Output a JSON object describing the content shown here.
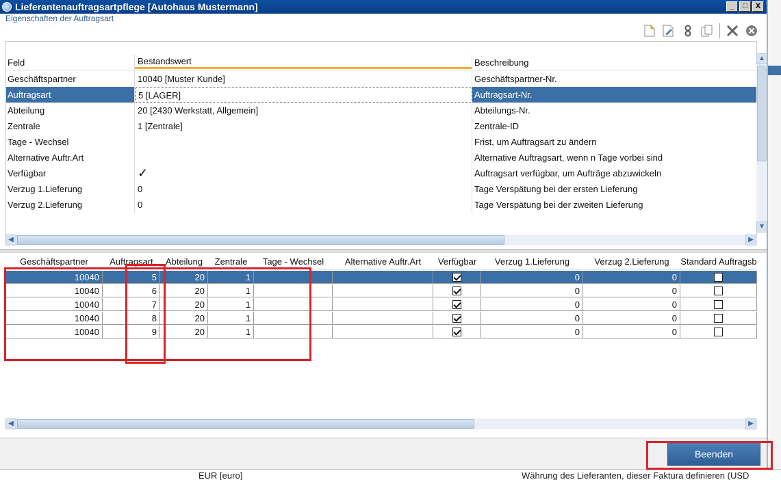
{
  "window": {
    "title": "Lieferantenauftragsartpflege [Autohaus Mustermann]",
    "subtitle": "Eigenschaften der Auftragsart",
    "controls": [
      "_",
      "□",
      "X"
    ]
  },
  "toolbar": {
    "icons": [
      "new-document-icon",
      "edit-document-icon",
      "link-icon",
      "copy-icon",
      "delete-icon",
      "close-circle-icon"
    ]
  },
  "properties": {
    "headers": {
      "field": "Feld",
      "value": "Bestandswert",
      "description": "Beschreibung"
    },
    "rows": [
      {
        "field": "Geschäftspartner",
        "value": "10040   [Muster Kunde]",
        "description": "Geschäftspartner-Nr."
      },
      {
        "field": "Auftragsart",
        "value": "5   [LAGER]",
        "description": "Auftragsart-Nr."
      },
      {
        "field": "Abteilung",
        "value": "20   [2430 Werkstatt,  Allgemein]",
        "description": "Abteilungs-Nr."
      },
      {
        "field": "Zentrale",
        "value": "1   [Zentrale]",
        "description": "Zentrale-ID"
      },
      {
        "field": "Tage - Wechsel",
        "value": "",
        "description": "Frist, um Auftragsart zu ändern"
      },
      {
        "field": "Alternative Auftr.Art",
        "value": "",
        "description": "Alternative Auftragsart, wenn n Tage vorbei sind"
      },
      {
        "field": "Verfügbar",
        "value": "✓",
        "description": "Auftragsart verfügbar, um Aufträge abzuwickeln"
      },
      {
        "field": "Verzug 1.Lieferung",
        "value": "0",
        "description": "Tage Verspätung bei der ersten Lieferung"
      },
      {
        "field": "Verzug 2.Lieferung",
        "value": "0",
        "description": "Tage Verspätung bei der zweiten Lieferung"
      }
    ]
  },
  "table": {
    "columns": [
      "Geschäftspartner",
      "Auftragsart",
      "Abteilung",
      "Zentrale",
      "Tage - Wechsel",
      "Alternative Auftr.Art",
      "Verfügbar",
      "Verzug 1.Lieferung",
      "Verzug 2.Lieferung",
      "Standard Auftragsb"
    ],
    "rows": [
      {
        "partner": "10040",
        "art": "5",
        "abteilung": "20",
        "zentrale": "1",
        "tage": "",
        "alt": "",
        "verfuegbar": true,
        "verzug1": "0",
        "verzug2": "0",
        "standard": false
      },
      {
        "partner": "10040",
        "art": "6",
        "abteilung": "20",
        "zentrale": "1",
        "tage": "",
        "alt": "",
        "verfuegbar": true,
        "verzug1": "0",
        "verzug2": "0",
        "standard": false
      },
      {
        "partner": "10040",
        "art": "7",
        "abteilung": "20",
        "zentrale": "1",
        "tage": "",
        "alt": "",
        "verfuegbar": true,
        "verzug1": "0",
        "verzug2": "0",
        "standard": false
      },
      {
        "partner": "10040",
        "art": "8",
        "abteilung": "20",
        "zentrale": "1",
        "tage": "",
        "alt": "",
        "verfuegbar": true,
        "verzug1": "0",
        "verzug2": "0",
        "standard": false
      },
      {
        "partner": "10040",
        "art": "9",
        "abteilung": "20",
        "zentrale": "1",
        "tage": "",
        "alt": "",
        "verfuegbar": true,
        "verzug1": "0",
        "verzug2": "0",
        "standard": false
      }
    ]
  },
  "footer": {
    "close_label": "Beenden"
  },
  "background": {
    "bottom_left": "EUR   [euro]",
    "bottom_right": "Währung des Lieferanten, dieser Faktura definieren (USD"
  },
  "colors": {
    "selection": "#3b70a7",
    "title_bar": "#0c4fa0",
    "highlight": "#d9232a",
    "accent_underline": "#f3b03a"
  }
}
